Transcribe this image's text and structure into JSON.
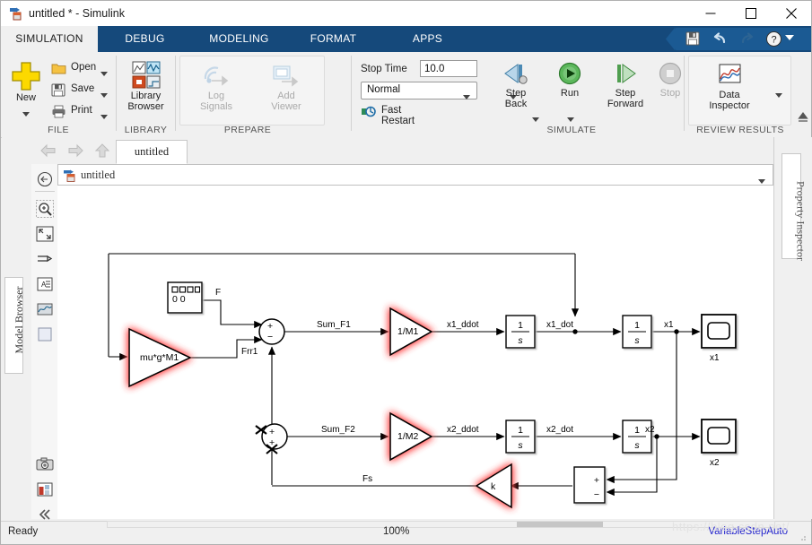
{
  "window": {
    "title": "untitled * - Simulink",
    "icon": "simulink-logo-icon",
    "minimize": "minimize-icon",
    "maximize": "maximize-icon",
    "close": "close-icon"
  },
  "ribbon": {
    "tabs": [
      {
        "label": "SIMULATION",
        "active": true
      },
      {
        "label": "DEBUG",
        "active": false
      },
      {
        "label": "MODELING",
        "active": false
      },
      {
        "label": "FORMAT",
        "active": false
      },
      {
        "label": "APPS",
        "active": false
      }
    ],
    "quick_access": [
      {
        "name": "save-icon"
      },
      {
        "name": "undo-icon"
      },
      {
        "name": "redo-icon"
      },
      {
        "name": "help-icon"
      },
      {
        "name": "chevron-down-icon"
      }
    ],
    "groups": [
      {
        "title": "FILE"
      },
      {
        "title": "LIBRARY"
      },
      {
        "title": "PREPARE"
      },
      {
        "title": "SIMULATE"
      },
      {
        "title": "REVIEW RESULTS"
      }
    ],
    "file": {
      "new_label": "New",
      "open_label": "Open",
      "save_label": "Save",
      "print_label": "Print"
    },
    "library": {
      "line1": "Library",
      "line2": "Browser"
    },
    "prepare": {
      "log_signals_line1": "Log",
      "log_signals_line2": "Signals",
      "add_viewer_line1": "Add",
      "add_viewer_line2": "Viewer"
    },
    "simulate": {
      "stop_time_label": "Stop Time",
      "stop_time_value": "10.0",
      "mode_value": "Normal",
      "fast_restart_label": "Fast Restart",
      "step_back_line1": "Step",
      "step_back_line2": "Back",
      "run_label": "Run",
      "step_forward_line1": "Step",
      "step_forward_line2": "Forward",
      "stop_label": "Stop"
    },
    "review": {
      "data_inspector_line1": "Data",
      "data_inspector_line2": "Inspector"
    }
  },
  "nav": {
    "back": "back-arrow-icon",
    "forward": "forward-arrow-icon",
    "up": "up-arrow-icon",
    "model_tab": "untitled"
  },
  "left_dock": {
    "label": "Model Browser"
  },
  "right_dock": {
    "label": "Property Inspector"
  },
  "tool_rail": [
    {
      "name": "navigate-back-icon"
    },
    {
      "name": "zoom-in-icon"
    },
    {
      "name": "fit-to-view-icon"
    },
    {
      "name": "signal-route-icon"
    },
    {
      "name": "annotation-icon"
    },
    {
      "name": "scope-preview-icon"
    },
    {
      "name": "area-icon"
    },
    {
      "name": "camera-icon"
    },
    {
      "name": "compare-icon"
    },
    {
      "name": "collapse-icon"
    }
  ],
  "breadcrumb": {
    "icon": "model-icon",
    "text": "untitled",
    "chevron": "chevron-down-icon"
  },
  "status": {
    "ready": "Ready",
    "zoom": "100%",
    "solver": "VariableStepAuto",
    "watermark": "https://blog.csdn.net/"
  },
  "diagram": {
    "blocks": {
      "source_F": {
        "name": "signal-source-block"
      },
      "gain_mu": {
        "label": "mu*g*M1"
      },
      "sum_F1": {
        "signs": [
          "+",
          "−"
        ]
      },
      "gain_1_M1": {
        "label": "1/M1"
      },
      "int_1": {
        "num": "1",
        "den": "s"
      },
      "int_2": {
        "num": "1",
        "den": "s"
      },
      "scope_x1": {
        "label": "x1"
      },
      "sum_F2": {
        "signs": [
          "+",
          "+"
        ]
      },
      "gain_1_M2": {
        "label": "1/M2"
      },
      "int_3": {
        "num": "1",
        "den": "s"
      },
      "int_4": {
        "num": "1",
        "den": "s"
      },
      "scope_x2": {
        "label": "x2"
      },
      "gain_k": {
        "label": "k"
      },
      "sum_diff": {
        "plus": "+",
        "minus": "−"
      }
    },
    "signals": {
      "F": "F",
      "Frr1": "Frr1",
      "Sum_F1": "Sum_F1",
      "x1_ddot": "x1_ddot",
      "x1_dot": "x1_dot",
      "x1": "x1",
      "Sum_F2": "Sum_F2",
      "x2_ddot": "x2_ddot",
      "x2_dot": "x2_dot",
      "x2": "x2",
      "Fs": "Fs"
    }
  }
}
